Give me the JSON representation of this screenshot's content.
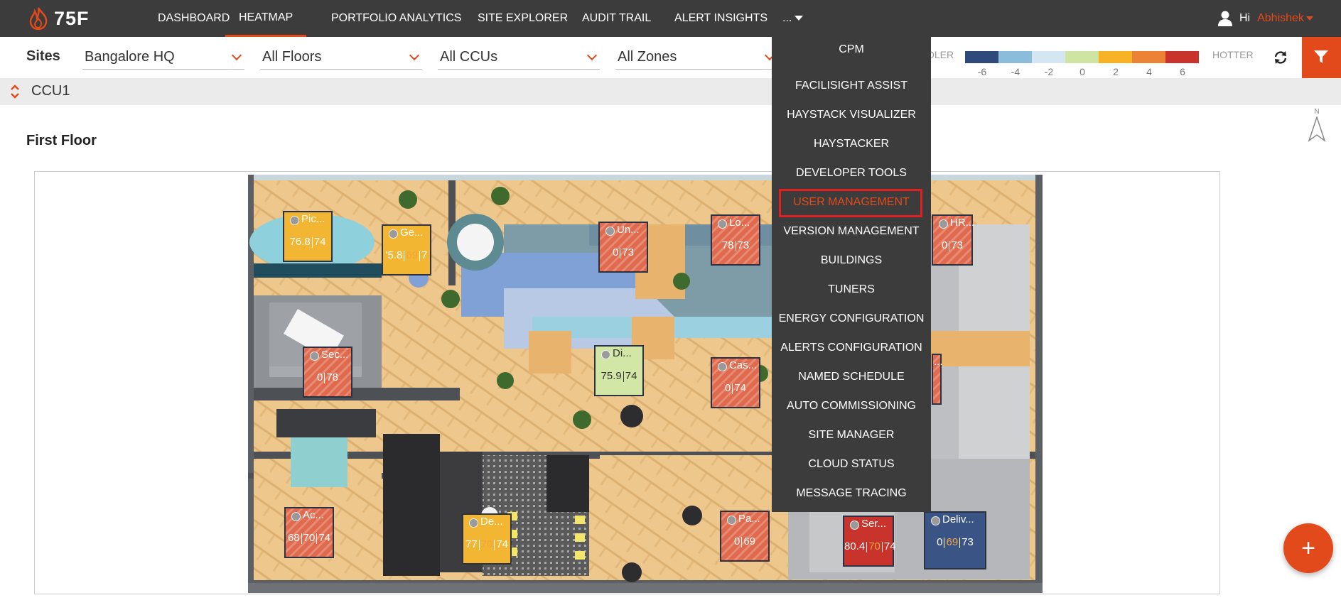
{
  "brand": {
    "logo_text": "75F"
  },
  "nav": {
    "items": [
      {
        "label": "DASHBOARD",
        "active": false
      },
      {
        "label": "HEATMAP",
        "active": true
      },
      {
        "label": "PORTFOLIO ANALYTICS",
        "active": false
      },
      {
        "label": "SITE EXPLORER",
        "active": false
      },
      {
        "label": "AUDIT TRAIL",
        "active": false
      },
      {
        "label": "ALERT INSIGHTS",
        "active": false
      }
    ],
    "more_label": "...",
    "greeting": "Hi",
    "user_name": "Abhishek"
  },
  "filters": {
    "sites_label": "Sites",
    "site": "Bangalore HQ",
    "floor": "All Floors",
    "ccu": "All CCUs",
    "zone": "All Zones"
  },
  "legend": {
    "cooler_label": "OLER",
    "hotter_label": "HOTTER",
    "ticks": [
      "-6",
      "-4",
      "-2",
      "0",
      "2",
      "4",
      "6"
    ],
    "colors": [
      "#2d4a7a",
      "#8bbcd9",
      "#d3e6f2",
      "#cfe3a3",
      "#f7b226",
      "#ec8236",
      "#c8332b"
    ]
  },
  "ccu": {
    "label": "CCU1"
  },
  "floor": {
    "title": "First Floor",
    "north_label": "N"
  },
  "zones": [
    {
      "name": "Pic...",
      "values": [
        "76.8",
        "74"
      ],
      "color": "#f2b632",
      "hatch": false,
      "light": false
    },
    {
      "name": "Ge...",
      "values": [
        "'5.8",
        "69",
        "7"
      ],
      "color": "#f2b632",
      "hatch": false,
      "light": false
    },
    {
      "name": "Un...",
      "values": [
        "0",
        "73"
      ],
      "color": "#e06a4d",
      "hatch": true,
      "light": false
    },
    {
      "name": "Lo...",
      "values": [
        "78",
        "73"
      ],
      "color": "#e06a4d",
      "hatch": true,
      "light": false
    },
    {
      "name": "HR...",
      "values": [
        "0",
        "73"
      ],
      "color": "#e06a4d",
      "hatch": true,
      "light": false
    },
    {
      "name": "Sec...",
      "values": [
        "0",
        "78"
      ],
      "color": "#e06a4d",
      "hatch": true,
      "light": false
    },
    {
      "name": "Di...",
      "values": [
        "75.9",
        "74"
      ],
      "color": "#d2e6a6",
      "hatch": false,
      "light": true
    },
    {
      "name": "Cas...",
      "values": [
        "0",
        "74"
      ],
      "color": "#e06a4d",
      "hatch": true,
      "light": false
    },
    {
      "name": "...",
      "values": [],
      "color": "#e06a4d",
      "hatch": true,
      "light": false
    },
    {
      "name": "Ac...",
      "values": [
        "68",
        "70",
        "74"
      ],
      "color": "#e06a4d",
      "hatch": true,
      "light": false
    },
    {
      "name": "De...",
      "values": [
        "77",
        "70",
        "74"
      ],
      "color": "#f2b632",
      "hatch": false,
      "light": false
    },
    {
      "name": "Pa...",
      "values": [
        "0",
        "69"
      ],
      "color": "#e06a4d",
      "hatch": true,
      "light": false
    },
    {
      "name": "Ser...",
      "values": [
        "80.4",
        "70",
        "74"
      ],
      "color": "#c8332b",
      "hatch": false,
      "light": false
    },
    {
      "name": "Deliv...",
      "values": [
        "0",
        "69",
        "73"
      ],
      "color": "#3a5486",
      "hatch": false,
      "light": false
    }
  ],
  "menu": {
    "items": [
      "CPM",
      "FACILISIGHT ASSIST",
      "HAYSTACK VISUALIZER",
      "HAYSTACKER",
      "DEVELOPER TOOLS",
      "USER MANAGEMENT",
      "VERSION MANAGEMENT",
      "BUILDINGS",
      "TUNERS",
      "ENERGY CONFIGURATION",
      "ALERTS CONFIGURATION",
      "NAMED SCHEDULE",
      "AUTO COMMISSIONING",
      "SITE MANAGER",
      "CLOUD STATUS",
      "MESSAGE TRACING"
    ],
    "selected": "USER MANAGEMENT"
  },
  "fab": {
    "label": "+"
  }
}
